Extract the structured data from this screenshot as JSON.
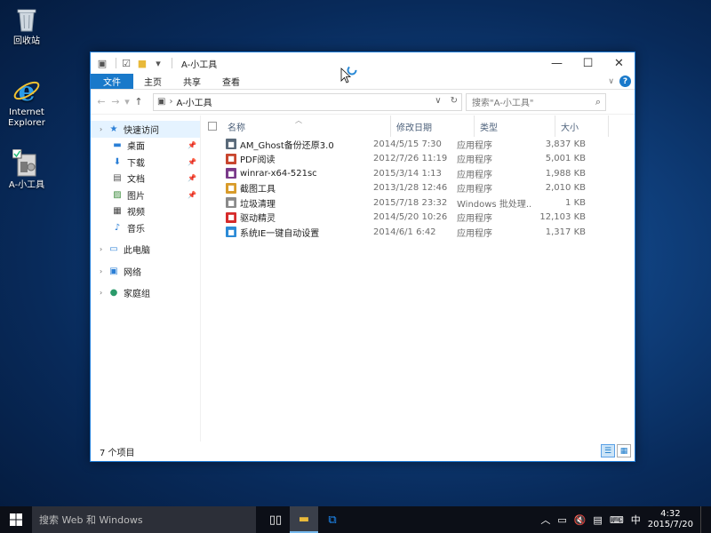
{
  "desktop": {
    "icons": [
      {
        "label": "回收站"
      },
      {
        "label": "Internet Explorer"
      },
      {
        "label": "A-小工具"
      }
    ]
  },
  "window": {
    "title": "A-小工具",
    "ribbon_tabs": [
      "文件",
      "主页",
      "共享",
      "查看"
    ],
    "address": {
      "segment": "A-小工具"
    },
    "search_placeholder": "搜索\"A-小工具\"",
    "nav": {
      "quick_access": "快速访问",
      "pinned": [
        "桌面",
        "下载",
        "文档",
        "图片"
      ],
      "others": [
        "视频",
        "音乐"
      ],
      "this_pc": "此电脑",
      "network": "网络",
      "homegroup": "家庭组"
    },
    "columns": [
      "名称",
      "修改日期",
      "类型",
      "大小"
    ],
    "files": [
      {
        "name": "AM_Ghost备份还原3.0",
        "date": "2014/5/15 7:30",
        "type": "应用程序",
        "size": "3,837 KB",
        "icon_color": "#5a6a7a"
      },
      {
        "name": "PDF阅读",
        "date": "2012/7/26 11:19",
        "type": "应用程序",
        "size": "5,001 KB",
        "icon_color": "#c8462e"
      },
      {
        "name": "winrar-x64-521sc",
        "date": "2015/3/14 1:13",
        "type": "应用程序",
        "size": "1,988 KB",
        "icon_color": "#7a3a8a"
      },
      {
        "name": "截图工具",
        "date": "2013/1/28 12:46",
        "type": "应用程序",
        "size": "2,010 KB",
        "icon_color": "#d89b2a"
      },
      {
        "name": "垃圾清理",
        "date": "2015/7/18 23:32",
        "type": "Windows 批处理...",
        "size": "1 KB",
        "icon_color": "#8a8a8a"
      },
      {
        "name": "驱动精灵",
        "date": "2014/5/20 10:26",
        "type": "应用程序",
        "size": "12,103 KB",
        "icon_color": "#d62b2b"
      },
      {
        "name": "系统IE一键自动设置",
        "date": "2014/6/1 6:42",
        "type": "应用程序",
        "size": "1,317 KB",
        "icon_color": "#2b8ad6"
      }
    ],
    "status": "7 个项目"
  },
  "taskbar": {
    "search_placeholder": "搜索 Web 和 Windows",
    "ime": "中",
    "time": "4:32",
    "date": "2015/7/20"
  }
}
